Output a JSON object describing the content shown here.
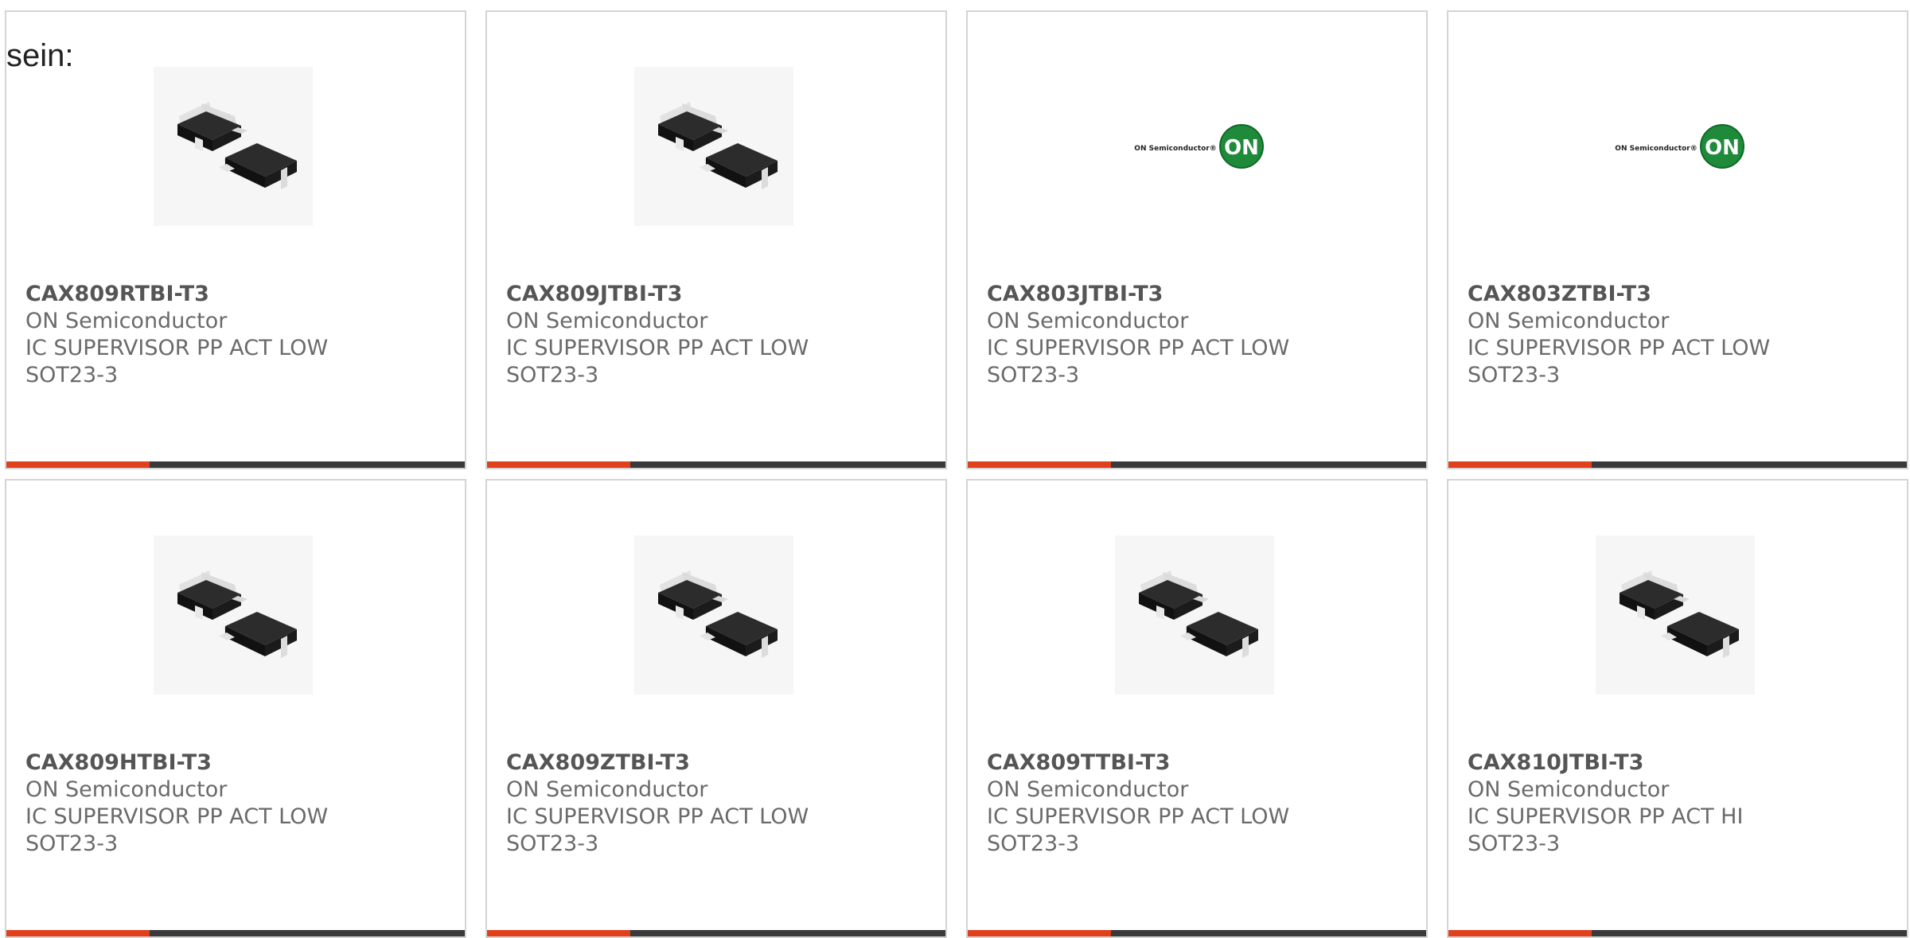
{
  "intro_text": "sein:",
  "colors": {
    "accent": "#e0401c",
    "bar": "#3a3a3a",
    "logo_green": "#1f8a3a"
  },
  "products": [
    {
      "part_number": "CAX809RTBI-T3",
      "manufacturer": "ON Semiconductor",
      "description_line1": "IC SUPERVISOR PP ACT LOW",
      "description_line2": "SOT23-3",
      "image": "sot23-package-image"
    },
    {
      "part_number": "CAX809JTBI-T3",
      "manufacturer": "ON Semiconductor",
      "description_line1": "IC SUPERVISOR PP ACT LOW",
      "description_line2": "SOT23-3",
      "image": "sot23-package-image"
    },
    {
      "part_number": "CAX803JTBI-T3",
      "manufacturer": "ON Semiconductor",
      "description_line1": "IC SUPERVISOR PP ACT LOW",
      "description_line2": "SOT23-3",
      "image": "on-semiconductor-logo",
      "logo_text": "ON Semiconductor®",
      "logo_badge": "ON"
    },
    {
      "part_number": "CAX803ZTBI-T3",
      "manufacturer": "ON Semiconductor",
      "description_line1": "IC SUPERVISOR PP ACT LOW",
      "description_line2": "SOT23-3",
      "image": "on-semiconductor-logo",
      "logo_text": "ON Semiconductor®",
      "logo_badge": "ON"
    },
    {
      "part_number": "CAX809HTBI-T3",
      "manufacturer": "ON Semiconductor",
      "description_line1": "IC SUPERVISOR PP ACT LOW",
      "description_line2": "SOT23-3",
      "image": "sot23-package-image"
    },
    {
      "part_number": "CAX809ZTBI-T3",
      "manufacturer": "ON Semiconductor",
      "description_line1": "IC SUPERVISOR PP ACT LOW",
      "description_line2": "SOT23-3",
      "image": "sot23-package-image"
    },
    {
      "part_number": "CAX809TTBI-T3",
      "manufacturer": "ON Semiconductor",
      "description_line1": "IC SUPERVISOR PP ACT LOW",
      "description_line2": "SOT23-3",
      "image": "sot23-package-image"
    },
    {
      "part_number": "CAX810JTBI-T3",
      "manufacturer": "ON Semiconductor",
      "description_line1": "IC SUPERVISOR PP ACT HI",
      "description_line2": "SOT23-3",
      "image": "sot23-package-image"
    }
  ]
}
